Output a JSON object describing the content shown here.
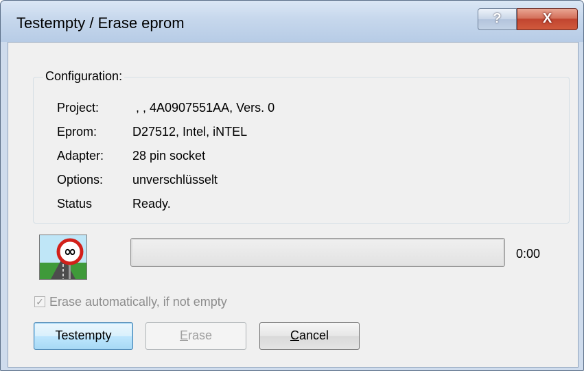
{
  "window": {
    "title": "Testempty / Erase eprom",
    "help_glyph": "?",
    "close_glyph": "X"
  },
  "config": {
    "legend": "Configuration:",
    "rows": [
      {
        "label": "Project:",
        "value": " , , 4A0907551AA, Vers. 0"
      },
      {
        "label": "Eprom:",
        "value": "D27512, Intel, iNTEL"
      },
      {
        "label": "Adapter:",
        "value": "28 pin socket"
      },
      {
        "label": "Options:",
        "value": "unverschlüsselt"
      },
      {
        "label": "Status",
        "value": "Ready."
      }
    ]
  },
  "progress": {
    "time": "0:00",
    "fraction": 0
  },
  "erase_auto": {
    "label": "Erase automatically, if not empty",
    "checked": true,
    "enabled": false
  },
  "buttons": {
    "testempty": "Testempty",
    "erase_mnemonic": "E",
    "erase_rest": "rase",
    "cancel_mnemonic": "C",
    "cancel_rest": "ancel"
  },
  "icons": {
    "status_sign": "infinity-road-sign-icon"
  }
}
